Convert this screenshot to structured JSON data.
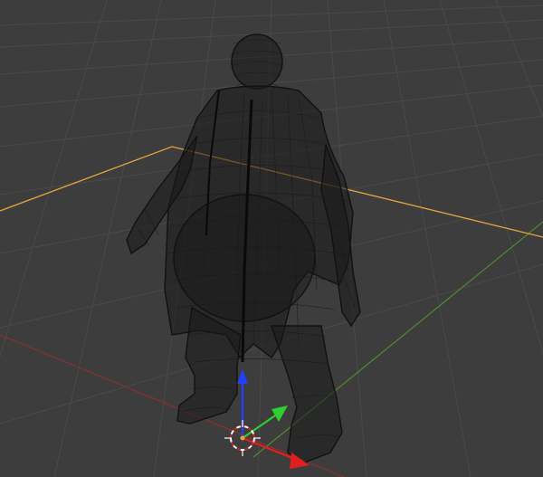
{
  "viewport": {
    "background": "#3d3d3d",
    "grid_color": "#4a4a4a",
    "axis_x_color": "#8b2f2f",
    "axis_y_color": "#4f8a2e",
    "selection_outline_color": "#e8a33c",
    "wire_color": "#111111"
  },
  "gizmo": {
    "x_arrow_color": "#e02020",
    "y_arrow_color": "#2fcf2f",
    "z_arrow_color": "#2040ff",
    "icons": [
      "translate-arrow-x",
      "translate-arrow-y",
      "translate-arrow-z",
      "3d-cursor-icon"
    ]
  },
  "object": {
    "display_mode": "wireframe",
    "icon": "character-mesh"
  }
}
